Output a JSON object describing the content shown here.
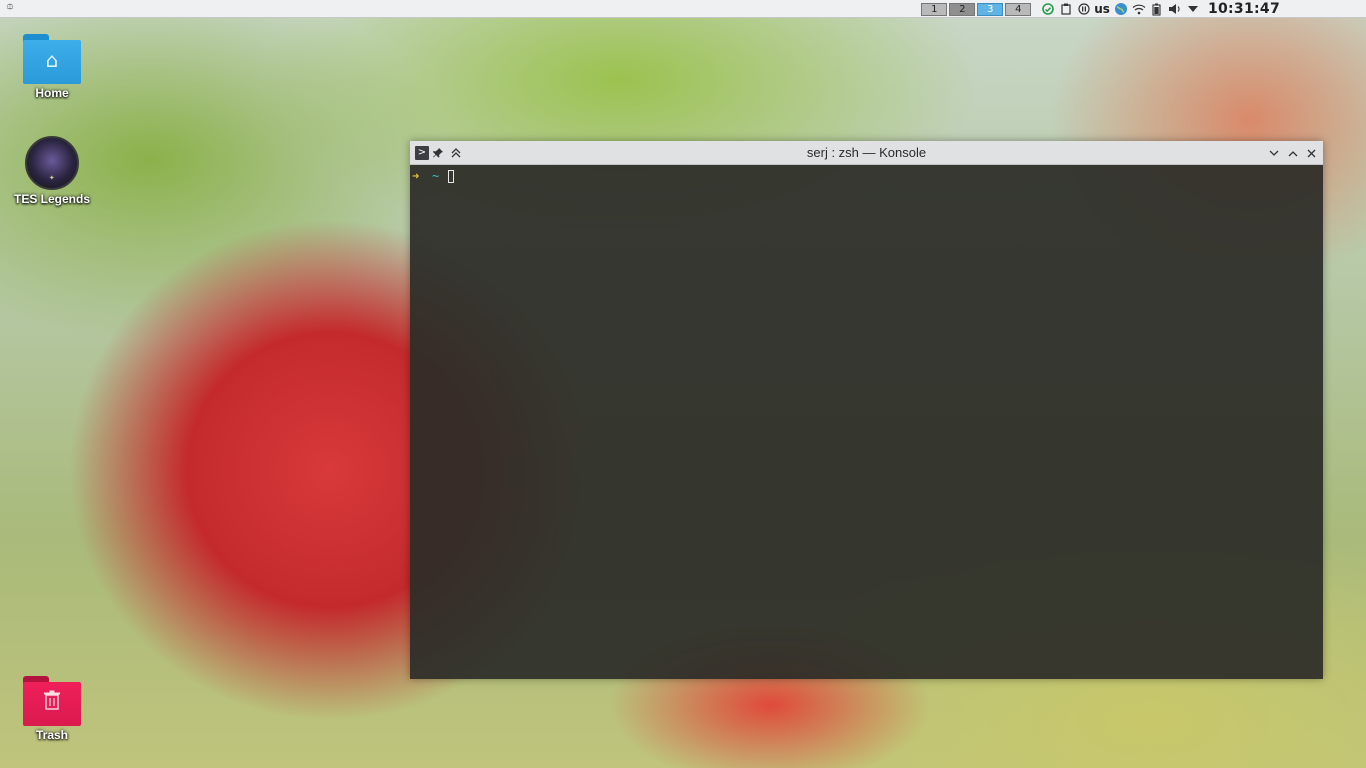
{
  "panel": {
    "launcher_icon": "launcher-icon",
    "pager": {
      "desktops": [
        {
          "label": "1",
          "active": false
        },
        {
          "label": "2",
          "active": false
        },
        {
          "label": "3",
          "active": true
        },
        {
          "label": "4",
          "active": false
        }
      ]
    },
    "tray": {
      "icons": [
        "cloud-sync-icon",
        "clipboard-icon",
        "media-pause-icon"
      ],
      "keyboard_layout": "us",
      "icons_after": [
        "network-globe-icon",
        "wifi-icon",
        "battery-icon",
        "volume-icon",
        "expand-tray-icon"
      ]
    },
    "clock": "10:31:47"
  },
  "desktop": {
    "icons": [
      {
        "label": "Home",
        "icon": "home-folder-icon"
      },
      {
        "label": "TES Legends",
        "icon": "tes-legends-app-icon"
      },
      {
        "label": "Trash",
        "icon": "trash-folder-icon"
      }
    ]
  },
  "window": {
    "title": "serj : zsh — Konsole",
    "terminal": {
      "prompt_arrow": "➜",
      "prompt_dir": "~"
    }
  },
  "colors": {
    "accent": "#3daee9",
    "trash": "#e91e5a",
    "panel_bg": "#eff0f1",
    "terminal_bg": "#2c2c28",
    "prompt_arrow": "#e6c33a",
    "prompt_dir": "#3fc0c8"
  }
}
